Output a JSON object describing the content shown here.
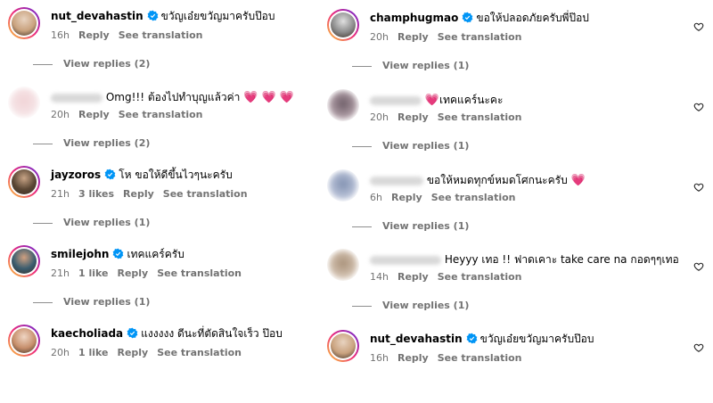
{
  "left": [
    {
      "username": "nut_devahastin",
      "verified": true,
      "text": "ขวัญเอ๋ยขวัญมาครับป๊อบ",
      "emoji": "",
      "time": "16h",
      "likes": "",
      "reply": "Reply",
      "translate": "See translation",
      "view_replies": "View replies (2)",
      "avatar": "photo",
      "blurred": false
    },
    {
      "username": "",
      "verified": false,
      "text": "Omg!!! ต้องไปทำบุญแล้วค่า",
      "emoji": "💗 💗 💗",
      "time": "20h",
      "likes": "",
      "reply": "Reply",
      "translate": "See translation",
      "view_replies": "View replies (2)",
      "avatar": "blurred",
      "blurred": true
    },
    {
      "username": "jayzoros",
      "verified": true,
      "text": "โห ขอให้ดีขึ้นไวๆนะครับ",
      "emoji": "",
      "time": "21h",
      "likes": "3 likes",
      "reply": "Reply",
      "translate": "See translation",
      "view_replies": "View replies (1)",
      "avatar": "photo",
      "blurred": false
    },
    {
      "username": "smilejohn",
      "verified": true,
      "text": "เทคแคร์ครับ",
      "emoji": "",
      "time": "21h",
      "likes": "1 like",
      "reply": "Reply",
      "translate": "See translation",
      "view_replies": "View replies (1)",
      "avatar": "photo",
      "blurred": false
    },
    {
      "username": "kaecholiada",
      "verified": true,
      "text": "แงงงงง ดีนะที่ตัดสินใจเร็ว ป๊อบ",
      "emoji": "",
      "time": "20h",
      "likes": "1 like",
      "reply": "Reply",
      "translate": "See translation",
      "view_replies": "",
      "avatar": "photo",
      "blurred": false
    }
  ],
  "right": [
    {
      "username": "champhugmao",
      "verified": true,
      "text": "ขอให้ปลอดภัยครับพี่ป๊อป",
      "emoji": "",
      "time": "20h",
      "likes": "",
      "reply": "Reply",
      "translate": "See translation",
      "view_replies": "View replies (1)",
      "avatar": "photo",
      "blurred": false
    },
    {
      "username": "",
      "verified": false,
      "text": "เทคแคร์นะคะ",
      "emoji": "💗",
      "emoji_first": true,
      "time": "20h",
      "likes": "",
      "reply": "Reply",
      "translate": "See translation",
      "view_replies": "View replies (1)",
      "avatar": "blurred",
      "blurred": true
    },
    {
      "username": "",
      "verified": false,
      "text": "ขอให้หมดทุกข์หมดโศกนะครับ",
      "emoji": "💗",
      "time": "6h",
      "likes": "",
      "reply": "Reply",
      "translate": "See translation",
      "view_replies": "View replies (1)",
      "avatar": "blurred",
      "blurred": true
    },
    {
      "username": "",
      "verified": false,
      "text": "Heyyy เทอ !! ฟาดเคาะ take care na กอดๆๆเทอ",
      "emoji": "",
      "time": "14h",
      "likes": "",
      "reply": "Reply",
      "translate": "See translation",
      "view_replies": "View replies (1)",
      "avatar": "blurred",
      "blurred": true
    },
    {
      "username": "nut_devahastin",
      "verified": true,
      "text": "ขวัญเอ๋ยขวัญมาครับป๊อบ",
      "emoji": "",
      "time": "16h",
      "likes": "",
      "reply": "Reply",
      "translate": "See translation",
      "view_replies": "",
      "avatar": "photo",
      "blurred": false
    }
  ],
  "colors": {
    "verified": "#0095f6",
    "heart": "#ed2d63",
    "meta": "#737373"
  },
  "icons": {
    "like": "heart-outline-icon",
    "verified": "verified-badge-icon"
  }
}
